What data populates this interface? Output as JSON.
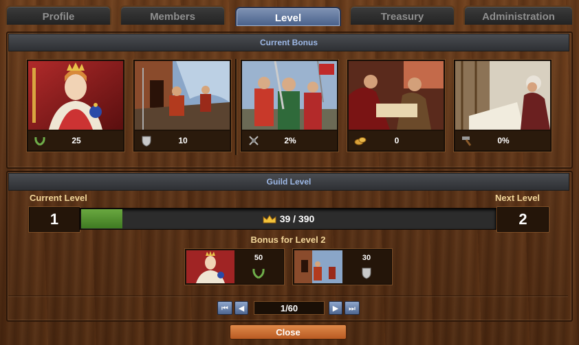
{
  "tabs": [
    {
      "label": "Profile"
    },
    {
      "label": "Members"
    },
    {
      "label": "Level"
    },
    {
      "label": "Treasury"
    },
    {
      "label": "Administration"
    }
  ],
  "current_bonus": {
    "header": "Current Bonus",
    "items": [
      {
        "icon": "laurel-icon",
        "value": "25"
      },
      {
        "icon": "shield-icon",
        "value": "10"
      },
      {
        "icon": "crossed-swords-icon",
        "value": "2%"
      },
      {
        "icon": "coins-icon",
        "value": "0"
      },
      {
        "icon": "hammer-icon",
        "value": "0%"
      }
    ]
  },
  "guild_level": {
    "header": "Guild Level",
    "current_label": "Current Level",
    "next_label": "Next Level",
    "current": "1",
    "next": "2",
    "progress_text": "39 / 390",
    "progress_value": 39,
    "progress_max": 390,
    "progress_icon": "crown-icon",
    "bonus_title": "Bonus for Level 2",
    "bonus_items": [
      {
        "value": "50",
        "icon": "laurel-icon"
      },
      {
        "value": "30",
        "icon": "shield-icon"
      }
    ]
  },
  "pagination": {
    "page_text": "1/60",
    "first": "⏮",
    "prev": "◀",
    "next": "▶",
    "last": "⏭"
  },
  "close_label": "Close",
  "colors": {
    "active_tab": "#5d739c",
    "progress_fill": "#4f8a2e",
    "label_gold": "#f3d79a",
    "header_blue": "#9db8e6"
  }
}
